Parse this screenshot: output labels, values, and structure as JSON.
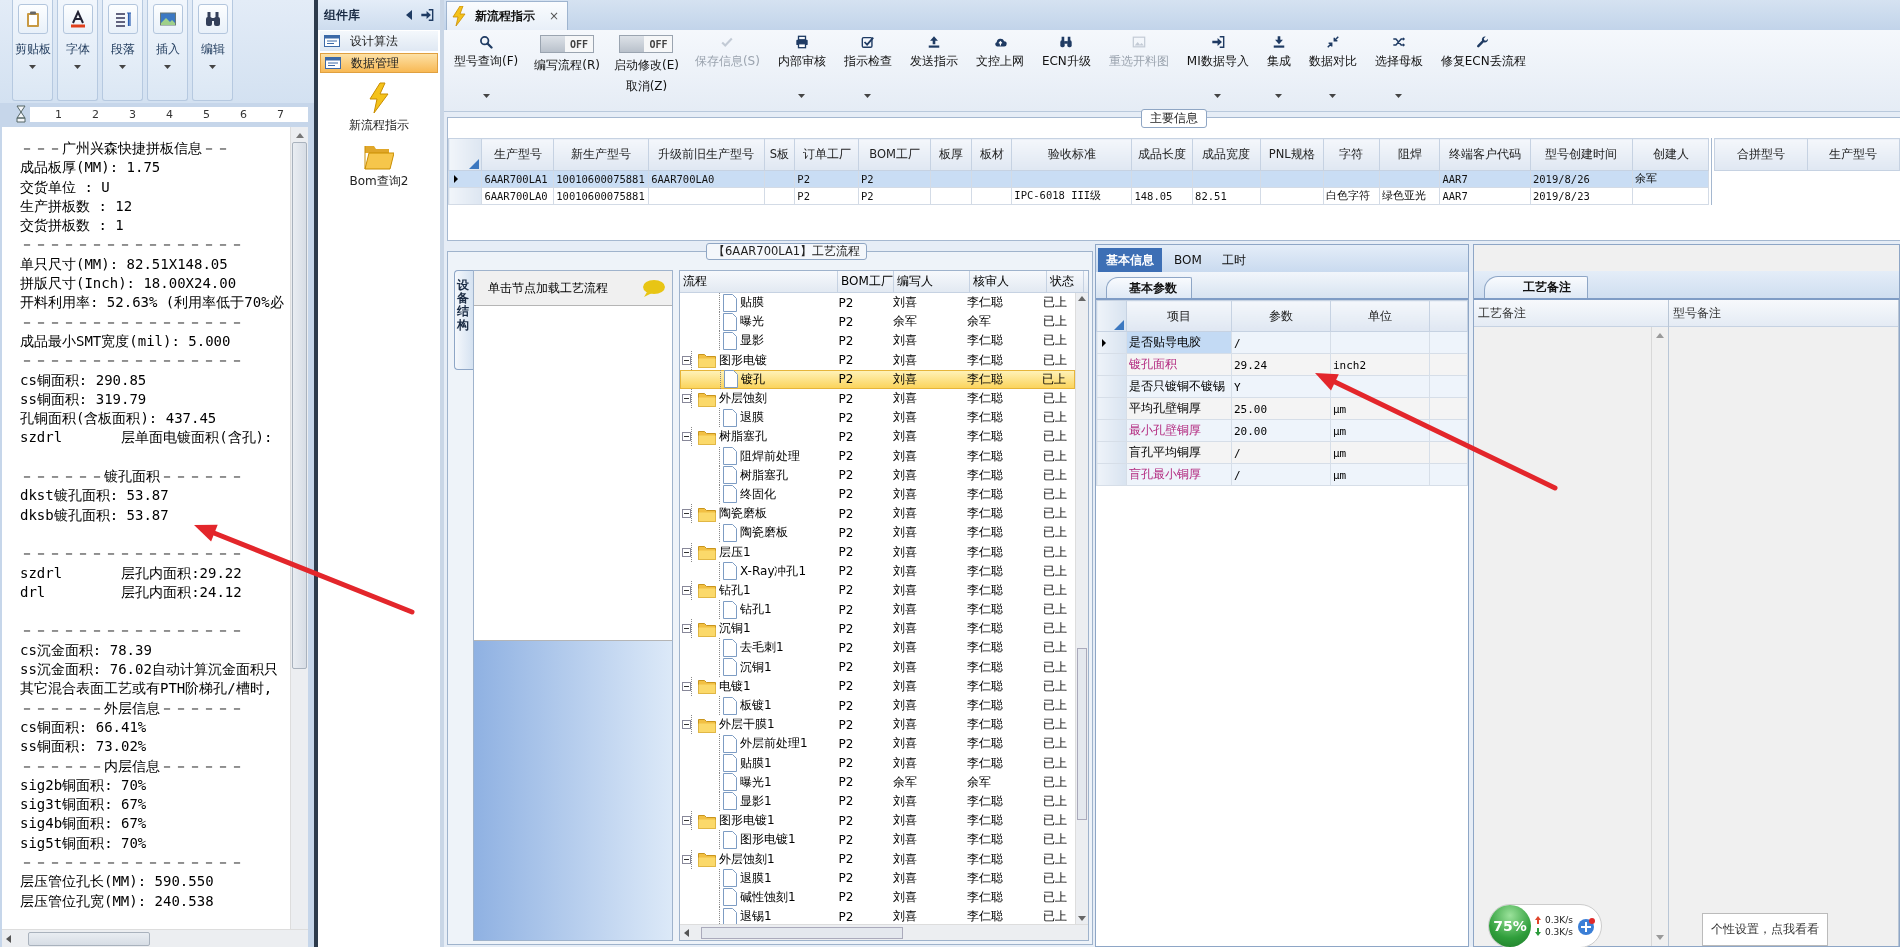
{
  "word": {
    "ribbon": [
      {
        "label": "剪贴板"
      },
      {
        "label": "字体"
      },
      {
        "label": "段落"
      },
      {
        "label": "插入"
      },
      {
        "label": "编辑"
      }
    ],
    "ruler": [
      "1",
      "2",
      "3",
      "4",
      "5",
      "6",
      "7"
    ],
    "lines": [
      {
        "kind": "text",
        "text": "－－－广州兴森快捷拼板信息－－"
      },
      {
        "kind": "text",
        "text": "成品板厚(MM): 1.75"
      },
      {
        "kind": "text",
        "text": "交货单位 : U"
      },
      {
        "kind": "text",
        "text": "生产拼板数 : 12"
      },
      {
        "kind": "text",
        "text": "交货拼板数 : 1"
      },
      {
        "kind": "text",
        "text": "－－－－－－－－－－－－－－－－"
      },
      {
        "kind": "text",
        "text": "单只尺寸(MM): 82.51X148.05"
      },
      {
        "kind": "text",
        "text": "拼版尺寸(Inch): 18.00X24.00"
      },
      {
        "kind": "text",
        "text": "开料利用率: 52.63% (利用率低于70%必"
      },
      {
        "kind": "text",
        "text": "－－－－－－－－－－－－－－－－"
      },
      {
        "kind": "text",
        "text": "成品最小SMT宽度(mil): 5.000"
      },
      {
        "kind": "text",
        "text": "－－－－－－－－－－－－－－－－"
      },
      {
        "kind": "text",
        "text": "cs铜面积: 290.85"
      },
      {
        "kind": "text",
        "text": "ss铜面积: 319.79"
      },
      {
        "kind": "text",
        "text": "孔铜面积(含板面积): 437.45"
      },
      {
        "kind": "text",
        "text": "szdrl       层单面电镀面积(含孔):"
      },
      {
        "kind": "blank"
      },
      {
        "kind": "text",
        "text": "－－－－－－镀孔面积－－－－－－"
      },
      {
        "kind": "text",
        "text": "dkst镀孔面积: 53.87"
      },
      {
        "kind": "text",
        "text": "dksb镀孔面积: 53.87"
      },
      {
        "kind": "blank"
      },
      {
        "kind": "text",
        "text": "－－－－－－－－－－－－－－－－"
      },
      {
        "kind": "text",
        "text": "szdrl       层孔内面积:29.22"
      },
      {
        "kind": "text",
        "text": "drl         层孔内面积:24.12"
      },
      {
        "kind": "blank"
      },
      {
        "kind": "text",
        "text": "－－－－－－－－－－－－－－－－"
      },
      {
        "kind": "text",
        "text": "cs沉金面积: 78.39"
      },
      {
        "kind": "text",
        "text": "ss沉金面积: 76.02自动计算沉金面积只"
      },
      {
        "kind": "text",
        "text": "其它混合表面工艺或有PTH阶梯孔/槽时,"
      },
      {
        "kind": "text",
        "text": "－－－－－－外层信息－－－－－－"
      },
      {
        "kind": "text",
        "text": "cs铜面积: 66.41%"
      },
      {
        "kind": "text",
        "text": "ss铜面积: 73.02%"
      },
      {
        "kind": "text",
        "text": "－－－－－－内层信息－－－－－－"
      },
      {
        "kind": "text",
        "text": "sig2b铜面积: 70%"
      },
      {
        "kind": "text",
        "text": "sig3t铜面积: 67%"
      },
      {
        "kind": "text",
        "text": "sig4b铜面积: 67%"
      },
      {
        "kind": "text",
        "text": "sig5t铜面积: 70%"
      },
      {
        "kind": "text",
        "text": "－－－－－－－－－－－－－－－－"
      },
      {
        "kind": "text",
        "text": "层压管位孔长(MM): 590.550"
      },
      {
        "kind": "text",
        "text": "层压管位孔宽(MM): 240.538"
      }
    ]
  },
  "component_library": {
    "title": "组件库",
    "items": [
      {
        "label": "设计算法",
        "selected": false
      },
      {
        "label": "数据管理",
        "selected": true
      }
    ],
    "shortcuts": [
      {
        "label": "新流程指示"
      },
      {
        "label": "Bom查询2"
      }
    ]
  },
  "document_tab": {
    "title": "新流程指示",
    "close": "×",
    "selected": true
  },
  "toolbar": [
    {
      "kind": "button",
      "label": "型号查询(F)",
      "dropdown": true,
      "disabled": false
    },
    {
      "kind": "toggle",
      "label": "编写流程(R)",
      "state_text": "OFF",
      "on": false
    },
    {
      "kind": "toggle",
      "label": "启动修改(E)",
      "label2": "取消(Z)",
      "state_text": "OFF",
      "on": false
    },
    {
      "kind": "button",
      "label": "保存信息(S)",
      "dropdown": false,
      "disabled": true
    },
    {
      "kind": "button",
      "label": "内部审核",
      "dropdown": true,
      "disabled": false
    },
    {
      "kind": "button",
      "label": "指示检查",
      "dropdown": true,
      "disabled": false
    },
    {
      "kind": "button",
      "label": "发送指示",
      "dropdown": false,
      "disabled": false
    },
    {
      "kind": "button",
      "label": "文控上网",
      "dropdown": false,
      "disabled": false
    },
    {
      "kind": "button",
      "label": "ECN升级",
      "dropdown": false,
      "disabled": false
    },
    {
      "kind": "button",
      "label": "重选开料图",
      "dropdown": false,
      "disabled": true
    },
    {
      "kind": "button",
      "label": "MI数据导入",
      "dropdown": true,
      "disabled": false
    },
    {
      "kind": "button",
      "label": "集成",
      "dropdown": true,
      "disabled": false
    },
    {
      "kind": "button",
      "label": "数据对比",
      "dropdown": true,
      "disabled": false
    },
    {
      "kind": "button",
      "label": "选择母板",
      "dropdown": true,
      "disabled": false
    },
    {
      "kind": "button",
      "label": "修复ECN丢流程",
      "dropdown": false,
      "disabled": false
    }
  ],
  "main_info": {
    "title": "主要信息",
    "columns": [
      "生产型号",
      "新生产型号",
      "升级前旧生产型号",
      "S板",
      "订单工厂",
      "BOM工厂",
      "板厚",
      "板材",
      "验收标准",
      "成品长度",
      "成品宽度",
      "PNL规格",
      "字符",
      "阻焊",
      "终端客户代码",
      "型号创建时间",
      "创建人"
    ],
    "rows": [
      {
        "selected": true,
        "cells": [
          "6AAR700LA1",
          "10010600075881",
          "6AAR700LA0",
          null,
          "P2",
          "P2",
          null,
          null,
          null,
          null,
          null,
          null,
          null,
          null,
          "AAR7",
          "2019/8/26",
          "余军"
        ]
      },
      {
        "selected": false,
        "cells": [
          "6AAR700LA0",
          "10010600075881",
          null,
          null,
          "P2",
          "P2",
          null,
          null,
          "IPC-6018 III级",
          "148.05",
          "82.51",
          null,
          "白色字符",
          "绿色亚光",
          "AAR7",
          "2019/8/23",
          null
        ]
      }
    ],
    "merge_columns": [
      "合拼型号",
      "生产型号"
    ]
  },
  "process_flow": {
    "title": "【6AAR700LA1】工艺流程",
    "side_tab": "设备结构",
    "hint": "单击节点加载工艺流程",
    "columns": [
      "流程",
      "BOM工厂",
      "编写人",
      "核审人",
      "状态"
    ],
    "nodes": [
      {
        "name": "贴膜",
        "bom": "P2",
        "writer": "刘喜",
        "reviewer": "李仁聪",
        "status": "已上",
        "selected": false
      },
      {
        "name": "曝光",
        "bom": "P2",
        "writer": "余军",
        "reviewer": "余军",
        "status": "已上",
        "selected": false
      },
      {
        "name": "显影",
        "bom": "P2",
        "writer": "刘喜",
        "reviewer": "李仁聪",
        "status": "已上",
        "selected": false
      },
      {
        "name": "图形电镀",
        "bom": "P2",
        "writer": "刘喜",
        "reviewer": "李仁聪",
        "status": "已上",
        "selected": false,
        "expanded": true,
        "children": [
          {
            "name": "镀孔",
            "bom": "P2",
            "writer": "刘喜",
            "reviewer": "李仁聪",
            "status": "已上",
            "selected": true
          }
        ]
      },
      {
        "name": "外层蚀刻",
        "bom": "P2",
        "writer": "刘喜",
        "reviewer": "李仁聪",
        "status": "已上",
        "selected": false,
        "expanded": true,
        "children": [
          {
            "name": "退膜",
            "bom": "P2",
            "writer": "刘喜",
            "reviewer": "李仁聪",
            "status": "已上",
            "selected": false
          }
        ]
      },
      {
        "name": "树脂塞孔",
        "bom": "P2",
        "writer": "刘喜",
        "reviewer": "李仁聪",
        "status": "已上",
        "selected": false,
        "expanded": true,
        "children": [
          {
            "name": "阻焊前处理",
            "bom": "P2",
            "writer": "刘喜",
            "reviewer": "李仁聪",
            "status": "已上",
            "selected": false
          },
          {
            "name": "树脂塞孔",
            "bom": "P2",
            "writer": "刘喜",
            "reviewer": "李仁聪",
            "status": "已上",
            "selected": false
          },
          {
            "name": "终固化",
            "bom": "P2",
            "writer": "刘喜",
            "reviewer": "李仁聪",
            "status": "已上",
            "selected": false
          }
        ]
      },
      {
        "name": "陶瓷磨板",
        "bom": "P2",
        "writer": "刘喜",
        "reviewer": "李仁聪",
        "status": "已上",
        "selected": false,
        "expanded": true,
        "children": [
          {
            "name": "陶瓷磨板",
            "bom": "P2",
            "writer": "刘喜",
            "reviewer": "李仁聪",
            "status": "已上",
            "selected": false
          }
        ]
      },
      {
        "name": "层压1",
        "bom": "P2",
        "writer": "刘喜",
        "reviewer": "李仁聪",
        "status": "已上",
        "selected": false,
        "expanded": true,
        "children": [
          {
            "name": "X-Ray冲孔1",
            "bom": "P2",
            "writer": "刘喜",
            "reviewer": "李仁聪",
            "status": "已上",
            "selected": false
          }
        ]
      },
      {
        "name": "钻孔1",
        "bom": "P2",
        "writer": "刘喜",
        "reviewer": "李仁聪",
        "status": "已上",
        "selected": false,
        "expanded": true,
        "children": [
          {
            "name": "钻孔1",
            "bom": "P2",
            "writer": "刘喜",
            "reviewer": "李仁聪",
            "status": "已上",
            "selected": false
          }
        ]
      },
      {
        "name": "沉铜1",
        "bom": "P2",
        "writer": "刘喜",
        "reviewer": "李仁聪",
        "status": "已上",
        "selected": false,
        "expanded": true,
        "children": [
          {
            "name": "去毛刺1",
            "bom": "P2",
            "writer": "刘喜",
            "reviewer": "李仁聪",
            "status": "已上",
            "selected": false
          },
          {
            "name": "沉铜1",
            "bom": "P2",
            "writer": "刘喜",
            "reviewer": "李仁聪",
            "status": "已上",
            "selected": false
          }
        ]
      },
      {
        "name": "电镀1",
        "bom": "P2",
        "writer": "刘喜",
        "reviewer": "李仁聪",
        "status": "已上",
        "selected": false,
        "expanded": true,
        "children": [
          {
            "name": "板镀1",
            "bom": "P2",
            "writer": "刘喜",
            "reviewer": "李仁聪",
            "status": "已上",
            "selected": false
          }
        ]
      },
      {
        "name": "外层干膜1",
        "bom": "P2",
        "writer": "刘喜",
        "reviewer": "李仁聪",
        "status": "已上",
        "selected": false,
        "expanded": true,
        "children": [
          {
            "name": "外层前处理1",
            "bom": "P2",
            "writer": "刘喜",
            "reviewer": "李仁聪",
            "status": "已上",
            "selected": false
          },
          {
            "name": "贴膜1",
            "bom": "P2",
            "writer": "刘喜",
            "reviewer": "李仁聪",
            "status": "已上",
            "selected": false
          },
          {
            "name": "曝光1",
            "bom": "P2",
            "writer": "余军",
            "reviewer": "余军",
            "status": "已上",
            "selected": false
          },
          {
            "name": "显影1",
            "bom": "P2",
            "writer": "刘喜",
            "reviewer": "李仁聪",
            "status": "已上",
            "selected": false
          }
        ]
      },
      {
        "name": "图形电镀1",
        "bom": "P2",
        "writer": "刘喜",
        "reviewer": "李仁聪",
        "status": "已上",
        "selected": false,
        "expanded": true,
        "children": [
          {
            "name": "图形电镀1",
            "bom": "P2",
            "writer": "刘喜",
            "reviewer": "李仁聪",
            "status": "已上",
            "selected": false
          }
        ]
      },
      {
        "name": "外层蚀刻1",
        "bom": "P2",
        "writer": "刘喜",
        "reviewer": "李仁聪",
        "status": "已上",
        "selected": false,
        "expanded": true,
        "children": [
          {
            "name": "退膜1",
            "bom": "P2",
            "writer": "刘喜",
            "reviewer": "李仁聪",
            "status": "已上",
            "selected": false
          },
          {
            "name": "碱性蚀刻1",
            "bom": "P2",
            "writer": "刘喜",
            "reviewer": "李仁聪",
            "status": "已上",
            "selected": false
          },
          {
            "name": "退锡1",
            "bom": "P2",
            "writer": "刘喜",
            "reviewer": "李仁聪",
            "status": "已上",
            "selected": false
          }
        ]
      }
    ]
  },
  "details": {
    "tabs": [
      {
        "label": "基本信息",
        "selected": true
      },
      {
        "label": "BOM",
        "selected": false
      },
      {
        "label": "工时",
        "selected": false
      }
    ],
    "panel_tab": "基本参数",
    "columns": [
      "项目",
      "参数",
      "单位"
    ],
    "rows": [
      {
        "item": "是否贴导电胶",
        "value": "/",
        "selected": true,
        "highlighted": false
      },
      {
        "item": "镀孔面积",
        "value": "29.24",
        "unit": "inch2",
        "selected": false,
        "highlighted": true
      },
      {
        "item": "是否只镀铜不镀锡",
        "value": "Y",
        "selected": false,
        "highlighted": false
      },
      {
        "item": "平均孔壁铜厚",
        "value": "25.00",
        "unit": "μm",
        "selected": false,
        "highlighted": false
      },
      {
        "item": "最小孔壁铜厚",
        "value": "20.00",
        "unit": "μm",
        "selected": false,
        "highlighted": true
      },
      {
        "item": "盲孔平均铜厚",
        "value": "/",
        "unit": "μm",
        "selected": false,
        "highlighted": false
      },
      {
        "item": "盲孔最小铜厚",
        "value": "/",
        "unit": "μm",
        "selected": false,
        "highlighted": true
      }
    ]
  },
  "remarks": {
    "tab": "工艺备注",
    "columns": [
      "工艺备注",
      "型号备注"
    ]
  },
  "monitor": {
    "percent": "75%",
    "upload": "0.3K/s",
    "download": "0.3K/s"
  },
  "tooltip": "个性设置，点我看看"
}
